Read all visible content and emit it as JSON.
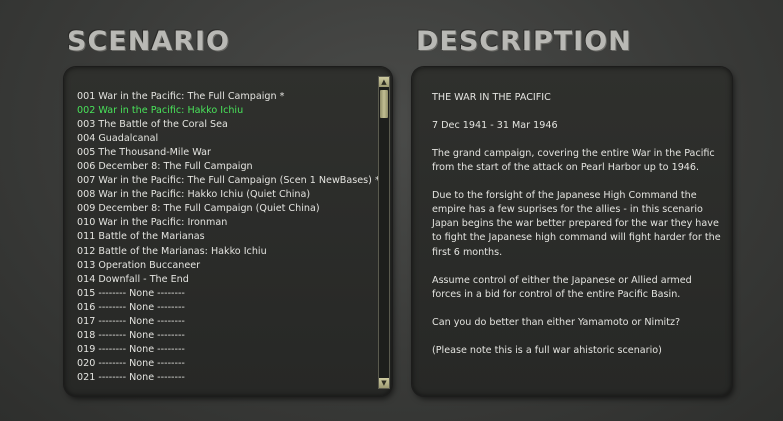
{
  "headings": {
    "scenario": "SCENARIO",
    "description": "DESCRIPTION"
  },
  "scenarios": [
    {
      "label": "001 War in the Pacific: The Full Campaign *",
      "selected": false
    },
    {
      "label": "002 War in the Pacific: Hakko Ichiu",
      "selected": true
    },
    {
      "label": "003 The Battle of the Coral Sea",
      "selected": false
    },
    {
      "label": "004 Guadalcanal",
      "selected": false
    },
    {
      "label": "005 The Thousand-Mile War",
      "selected": false
    },
    {
      "label": "006 December 8: The Full Campaign",
      "selected": false
    },
    {
      "label": "007 War in the Pacific: The Full Campaign (Scen 1 NewBases) *",
      "selected": false
    },
    {
      "label": "008 War in the Pacific: Hakko Ichiu (Quiet China)",
      "selected": false
    },
    {
      "label": "009 December 8: The Full Campaign (Quiet China)",
      "selected": false
    },
    {
      "label": "010 War in the Pacific: Ironman",
      "selected": false
    },
    {
      "label": "011 Battle of the Marianas",
      "selected": false
    },
    {
      "label": "012 Battle of the Marianas: Hakko Ichiu",
      "selected": false
    },
    {
      "label": "013 Operation Buccaneer",
      "selected": false
    },
    {
      "label": "014 Downfall - The End",
      "selected": false
    },
    {
      "label": "015 -------- None --------",
      "selected": false
    },
    {
      "label": "016 -------- None --------",
      "selected": false
    },
    {
      "label": "017 -------- None --------",
      "selected": false
    },
    {
      "label": "018 -------- None --------",
      "selected": false
    },
    {
      "label": "019 -------- None --------",
      "selected": false
    },
    {
      "label": "020 -------- None --------",
      "selected": false
    },
    {
      "label": "021 -------- None --------",
      "selected": false
    }
  ],
  "scrollbar": {
    "up_icon": "arrow-up-icon",
    "down_icon": "arrow-down-icon",
    "up_glyph": "▲",
    "down_glyph": "▼"
  },
  "description": {
    "title": "THE WAR IN THE PACIFIC",
    "dates": "7 Dec 1941 - 31 Mar 1946",
    "paragraph1": "The grand campaign, covering the entire War in the Pacific from the start of the attack on Pearl Harbor up to 1946.",
    "paragraph2": "Due to the forsight of the Japanese High Command the empire has a few suprises for the allies - in this scenario Japan begins the war better prepared for the war they have to fight the Japanese high command will fight harder for the first 6 months.",
    "paragraph3": "Assume control of either the Japanese or Allied armed forces in a bid for control of the entire Pacific Basin.",
    "paragraph4": "Can you do better than either Yamamoto or Nimitz?",
    "paragraph5": "(Please note this is a full war ahistoric scenario)"
  },
  "colors": {
    "selected": "#49e25a",
    "text": "#e4e4e0",
    "heading": "#b9b9b5"
  }
}
